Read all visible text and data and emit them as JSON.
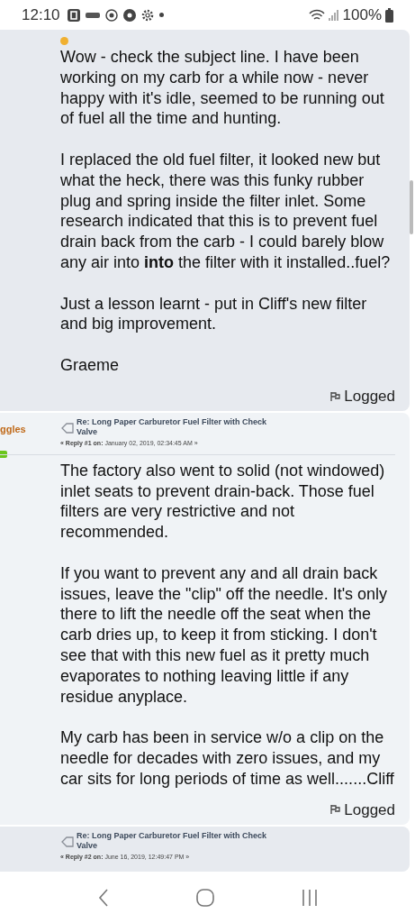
{
  "status_bar": {
    "time": "12:10",
    "battery": "100%"
  },
  "posts": [
    {
      "paragraphs": [
        "Wow - check the subject line. I have been working on my carb for a while now - never happy with it's idle, seemed to be running out of fuel all the time and hunting.",
        "I replaced the old fuel filter, it looked new but what the heck, there was this funky rubber plug and spring inside the filter inlet. Some research indicated that this is to prevent fuel drain back from the carb - I could barely blow any air into **into** the filter with it installed..fuel?",
        "Just a lesson learnt - put in Cliff's new filter and big improvement.",
        "Graeme"
      ],
      "logged": "Logged"
    },
    {
      "author": "ggles",
      "subject": "Re: Long Paper Carburetor Fuel Filter with Check Valve",
      "reply_label": "« Reply #1 on:",
      "date": "January 02, 2019, 02:34:45 AM »",
      "paragraphs": [
        "The factory also went to solid (not windowed) inlet seats to prevent drain-back.  Those fuel filters are very restrictive and not recommended.",
        "If you want to prevent any and all drain back issues, leave the \"clip\" off the needle.  It's only there to lift the needle off the seat when the carb dries up, to keep it from sticking.  I don't see that with this new fuel as it pretty much evaporates to nothing leaving little if any residue anyplace.",
        "My carb has been in service w/o a clip on the needle for decades with zero issues, and my car sits for long periods of time as well.......Cliff"
      ],
      "logged": "Logged"
    },
    {
      "subject": "Re: Long Paper Carburetor Fuel Filter with Check Valve",
      "reply_label": "« Reply #2 on:",
      "date": "June 16, 2019, 12:49:47 PM »"
    }
  ]
}
